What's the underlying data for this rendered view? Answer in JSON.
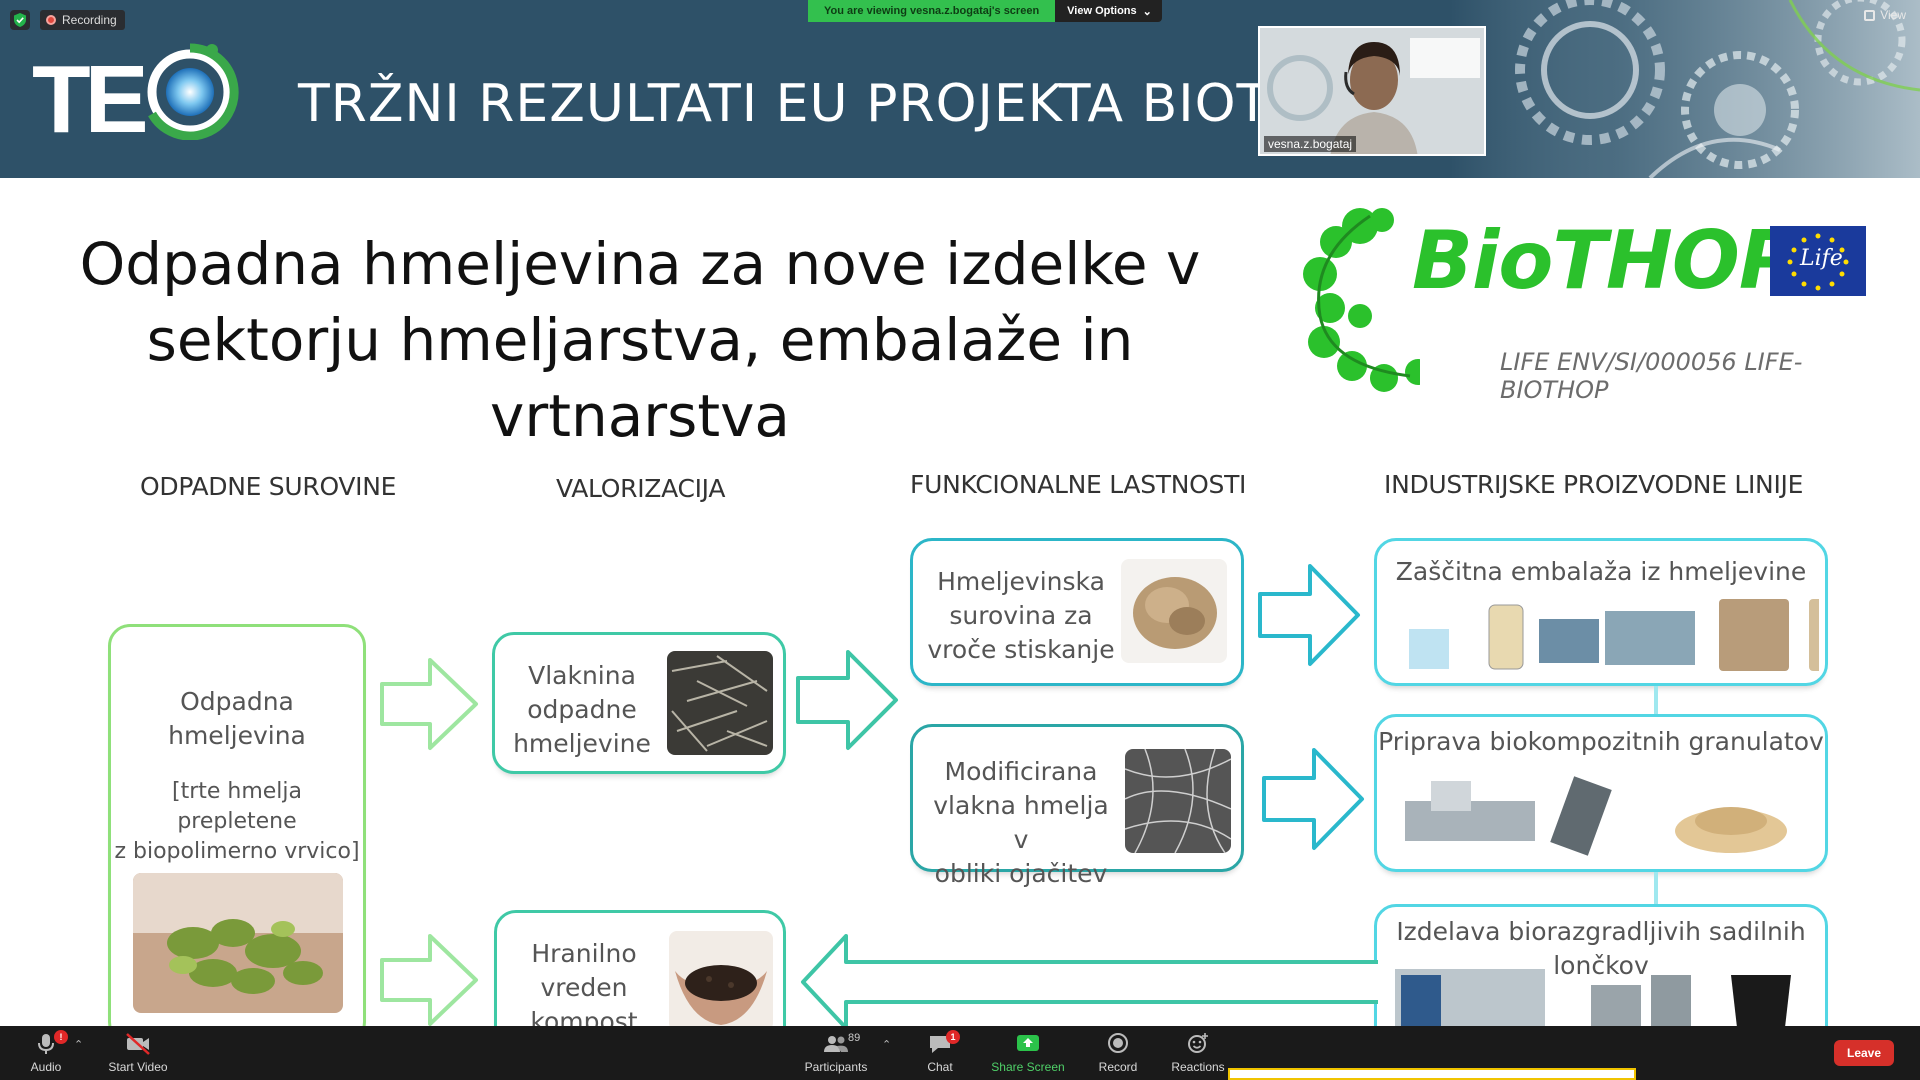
{
  "zoom": {
    "recording_label": "Recording",
    "viewing_text": "You are viewing vesna.z.bogataj's screen",
    "view_options_label": "View Options",
    "view_label": "View",
    "speaker_name": "vesna.z.bogataj"
  },
  "slide": {
    "header_title": "TRŽNI REZULTATI EU PROJEKTA BIOTHOP",
    "logo_text": "TE",
    "title_line1": "Odpadna hmeljevina za nove izdelke v",
    "title_line2": "sektorju hmeljarstva, embalaže in vrtnarstva",
    "biothop": {
      "word": "BioTHOP",
      "life": "Life",
      "code": "LIFE ENV/SI/000056 LIFE-BIOTHOP"
    },
    "headings": {
      "col1": "ODPADNE SUROVINE",
      "col2": "VALORIZACIJA",
      "col3": "FUNKCIONALNE LASTNOSTI",
      "col4": "INDUSTRIJSKE PROIZVODNE LINIJE"
    },
    "source_box": {
      "line1": "Odpadna",
      "line2": "hmeljevina",
      "line3": "[trte hmelja prepletene",
      "line4": "z biopolimerno vrvico]"
    },
    "valor_boxes": {
      "b1_l1": "Vlaknina",
      "b1_l2": "odpadne",
      "b1_l3": "hmeljevine",
      "b2_l1": "Hranilno",
      "b2_l2": "vreden",
      "b2_l3": "kompost"
    },
    "func_boxes": {
      "b1_l1": "Hmeljevinska",
      "b1_l2": "surovina za",
      "b1_l3": "vroče stiskanje",
      "b2_l1": "Modificirana",
      "b2_l2": "vlakna hmelja v",
      "b2_l3": "obliki ojačitev"
    },
    "industry_boxes": {
      "b1": "Zaščitna embalaža iz hmeljevine",
      "b2": "Priprava biokompozitnih granulatov",
      "b3": "Izdelava biorazgradljivih sadilnih lončkov"
    }
  },
  "toolbar": {
    "audio": "Audio",
    "audio_badge": "!",
    "start_video": "Start Video",
    "participants": "Participants",
    "participants_count": "89",
    "chat": "Chat",
    "chat_badge": "1",
    "share_screen": "Share Screen",
    "record": "Record",
    "reactions": "Reactions",
    "leave": "Leave"
  }
}
